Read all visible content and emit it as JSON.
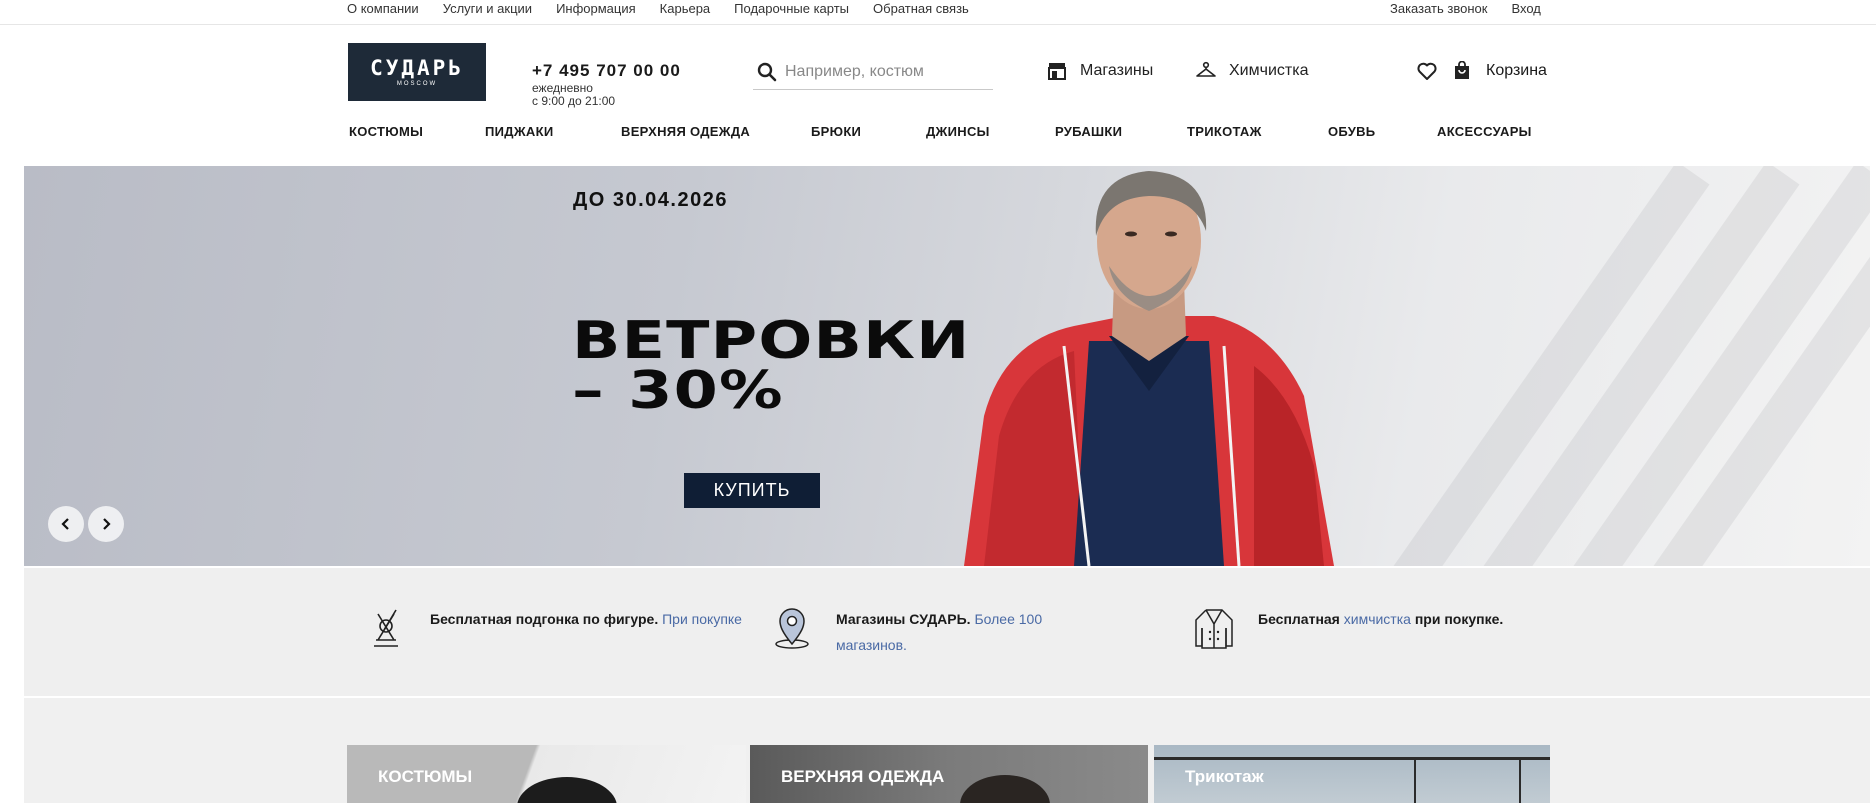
{
  "topbar": {
    "left_links": [
      "О компании",
      "Услуги и акции",
      "Информация",
      "Карьера",
      "Подарочные карты",
      "Обратная связь"
    ],
    "right_links": [
      "Заказать звонок",
      "Вход"
    ]
  },
  "header": {
    "logo_brand": "СУДАРЬ",
    "logo_sub": "MOSCOW",
    "phone": "+7 495 707 00 00",
    "hours_line1": "ежедневно",
    "hours_line2": "с 9:00 до 21:00",
    "search_placeholder": "Например, костюм",
    "stores_label": "Магазины",
    "cleaning_label": "Химчистка",
    "cart_label": "Корзина"
  },
  "categories_nav": [
    "КОСТЮМЫ",
    "ПИДЖАКИ",
    "ВЕРХНЯЯ ОДЕЖДА",
    "БРЮКИ",
    "ДЖИНСЫ",
    "РУБАШКИ",
    "ТРИКОТАЖ",
    "ОБУВЬ",
    "АКСЕССУАРЫ"
  ],
  "hero": {
    "date": "ДО 30.04.2026",
    "title_line1": "ВЕТРОВКИ",
    "title_line2": "– 30%",
    "buy_label": "КУПИТЬ",
    "prev_icon": "chevron-left-icon",
    "next_icon": "chevron-right-icon"
  },
  "benefits": [
    {
      "icon": "sewing-icon",
      "bold": "Бесплатная подгонка по фигуре.",
      "link": "При покупке",
      "tail": ""
    },
    {
      "icon": "location-pin-icon",
      "bold": "Магазины СУДАРЬ.",
      "link": "Более 100 магазинов.",
      "tail": ""
    },
    {
      "icon": "jacket-icon",
      "bold": "Бесплатная",
      "link": "химчистка",
      "tail": "при покупке."
    }
  ],
  "category_tiles": [
    "КОСТЮМЫ",
    "ВЕРХНЯЯ ОДЕЖДА",
    "Трикотаж"
  ],
  "colors": {
    "accent_blue": "#4a6aa5",
    "dark_navy": "#0f1e35",
    "logo_bg": "#1e2a38"
  }
}
